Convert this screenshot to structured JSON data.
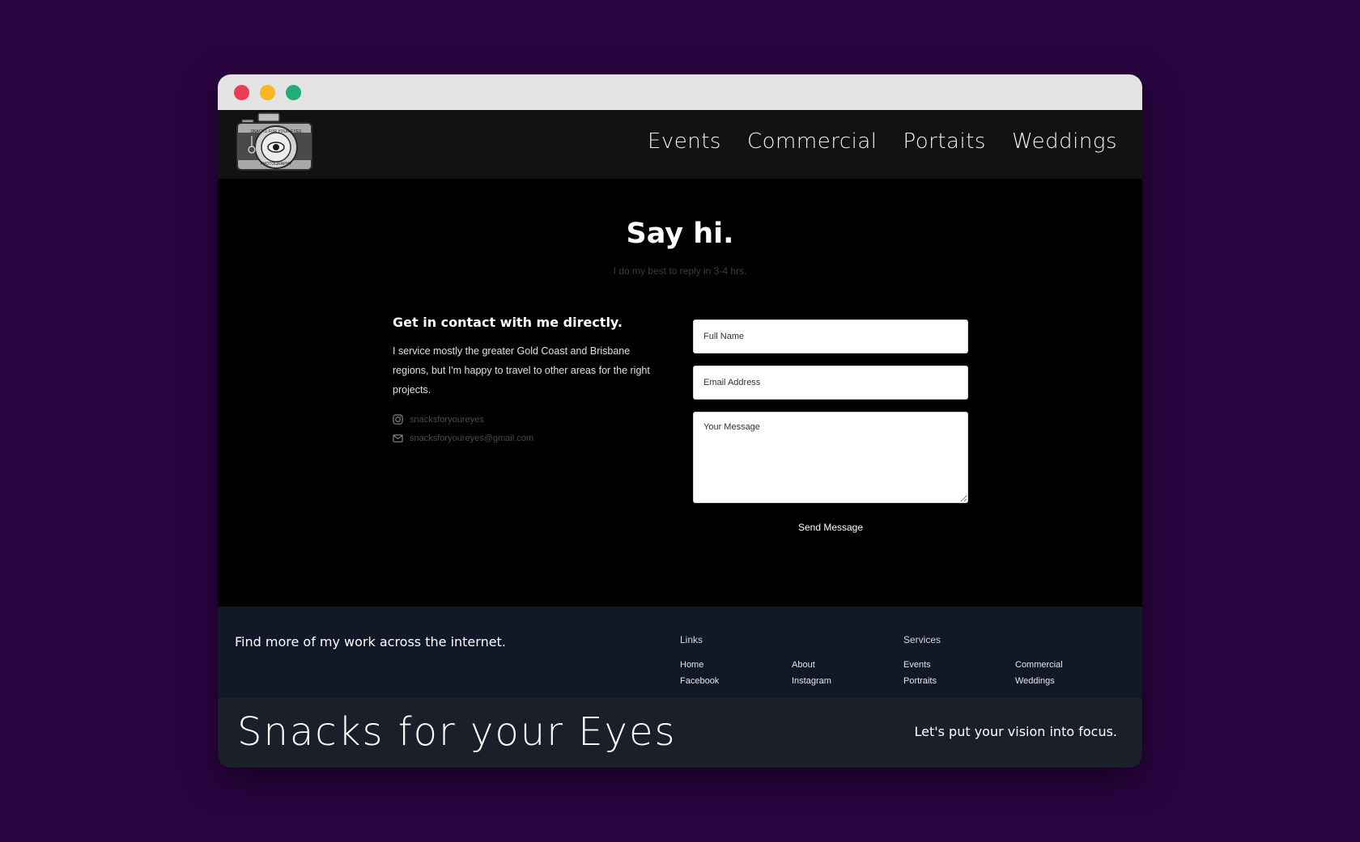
{
  "nav": {
    "items": [
      "Events",
      "Commercial",
      "Portaits",
      "Weddings"
    ]
  },
  "logo": {
    "text_top": "SNACKS FOR YOUR EYES",
    "text_bottom": "PHOTOGRAPHY"
  },
  "hero": {
    "title": "Say hi.",
    "subtitle": "I do my best to reply in 3-4 hrs."
  },
  "contact": {
    "heading": "Get in contact with me directly.",
    "body": "I service mostly the greater Gold Coast and Brisbane regions, but I'm happy to travel to other areas for the right projects.",
    "instagram": "snacksforyoureyes",
    "email": "snacksforyoureyes@gmail.com",
    "instagram_icon": "instagram-icon",
    "email_icon": "mail-icon"
  },
  "form": {
    "name_placeholder": "Full Name",
    "email_placeholder": "Email Address",
    "message_placeholder": "Your Message",
    "send_label": "Send Message"
  },
  "footer": {
    "tagline": "Find more of my work across the internet.",
    "links_heading": "Links",
    "links": [
      "Home",
      "About",
      "Facebook",
      "Instagram"
    ],
    "services_heading": "Services",
    "services": [
      "Events",
      "Commercial",
      "Portraits",
      "Weddings"
    ]
  },
  "bottom": {
    "brand": "Snacks for your Eyes",
    "tagline": "Let's put your vision into focus."
  },
  "colors": {
    "page_bg": "#2a0440",
    "header_bg": "#121212",
    "footer_bg": "#111827",
    "bottom_bg": "#1b1f29"
  }
}
